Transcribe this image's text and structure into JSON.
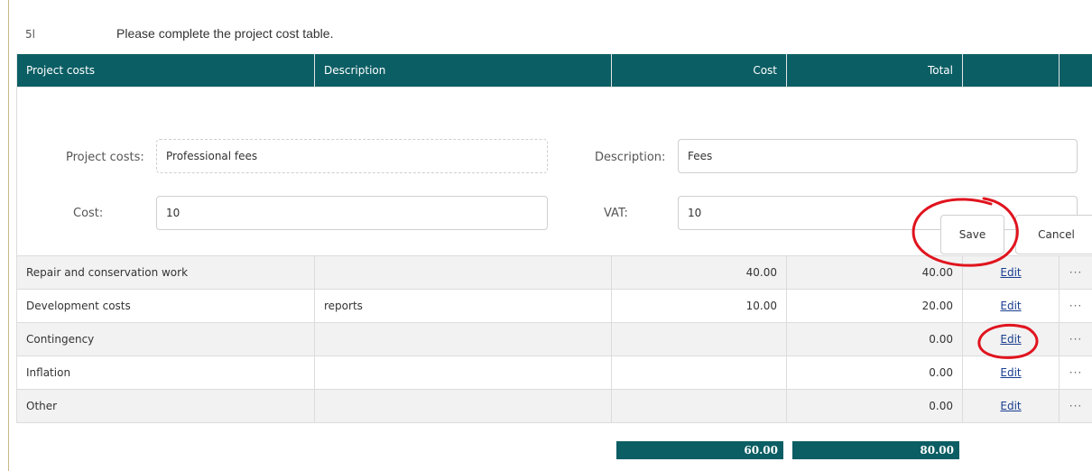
{
  "question": {
    "number": "5l",
    "text": "Please complete the project cost table."
  },
  "table": {
    "headers": [
      "Project costs",
      "Description",
      "Cost",
      "Total",
      "",
      ""
    ],
    "form": {
      "project_costs_label": "Project costs:",
      "project_costs_value": "Professional fees",
      "description_label": "Description:",
      "description_value": "Fees",
      "cost_label": "Cost:",
      "cost_value": "10",
      "vat_label": "VAT:",
      "vat_value": "10",
      "save_label": "Save",
      "cancel_label": "Cancel"
    },
    "rows": [
      {
        "project": "Repair and conservation work",
        "description": "",
        "cost": "40.00",
        "total": "40.00",
        "edit": "Edit",
        "more": "···"
      },
      {
        "project": "Development costs",
        "description": "reports",
        "cost": "10.00",
        "total": "20.00",
        "edit": "Edit",
        "more": "···"
      },
      {
        "project": "Contingency",
        "description": "",
        "cost": "",
        "total": "0.00",
        "edit": "Edit",
        "more": "···"
      },
      {
        "project": "Inflation",
        "description": "",
        "cost": "",
        "total": "0.00",
        "edit": "Edit",
        "more": "···"
      },
      {
        "project": "Other",
        "description": "",
        "cost": "",
        "total": "0.00",
        "edit": "Edit",
        "more": "···"
      }
    ],
    "totals": {
      "cost": "60.00",
      "total": "80.00"
    }
  },
  "colors": {
    "header_bg": "#0b5e64",
    "annotation": "#e0141e",
    "link": "#1a3d8f"
  }
}
